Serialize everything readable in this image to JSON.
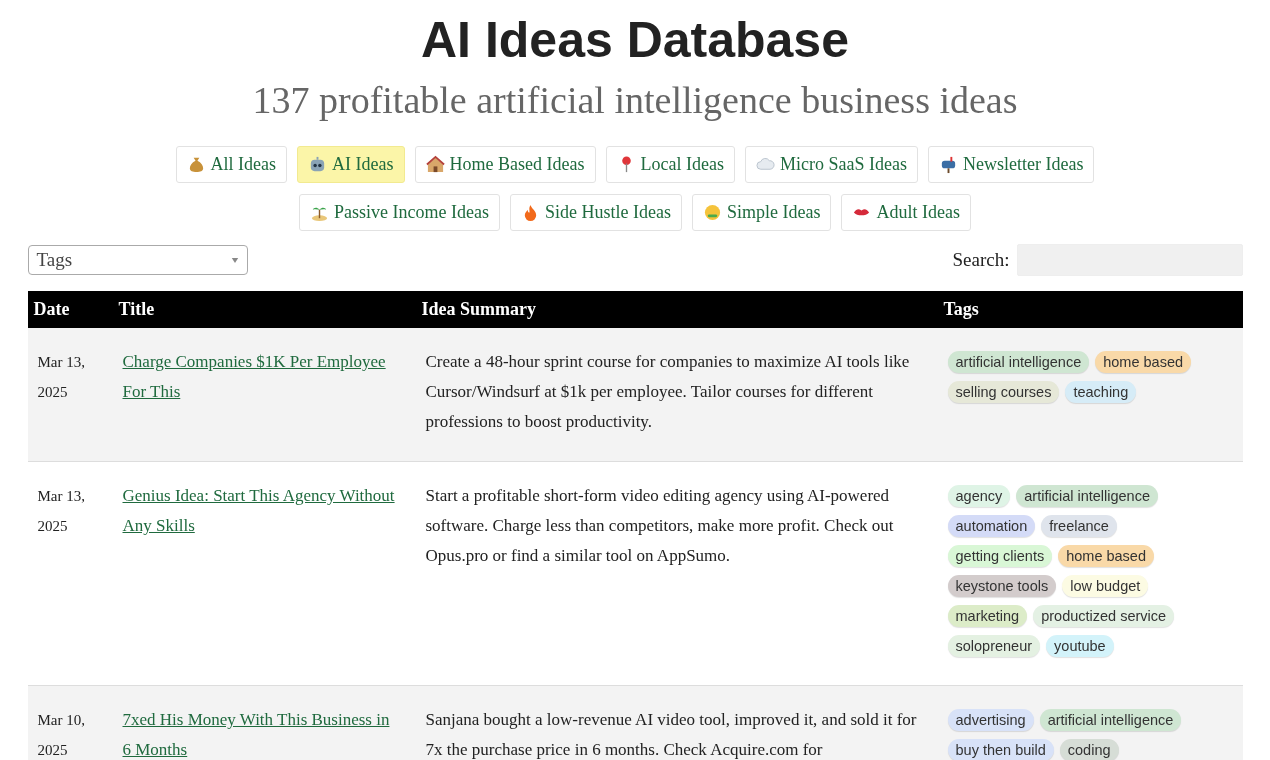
{
  "header": {
    "title": "AI Ideas Database",
    "subtitle": "137 profitable artificial intelligence business ideas"
  },
  "categories": [
    {
      "label": "All Ideas",
      "selected": false
    },
    {
      "label": "AI Ideas",
      "selected": true
    },
    {
      "label": "Home Based Ideas",
      "selected": false
    },
    {
      "label": "Local Ideas",
      "selected": false
    },
    {
      "label": "Micro SaaS Ideas",
      "selected": false
    },
    {
      "label": "Newsletter Ideas",
      "selected": false
    },
    {
      "label": "Passive Income Ideas",
      "selected": false
    },
    {
      "label": "Side Hustle Ideas",
      "selected": false
    },
    {
      "label": "Simple Ideas",
      "selected": false
    },
    {
      "label": "Adult Ideas",
      "selected": false
    }
  ],
  "filters": {
    "tags_placeholder": "Tags",
    "search_label": "Search:"
  },
  "table": {
    "columns": [
      "Date",
      "Title",
      "Idea Summary",
      "Tags"
    ],
    "rows": [
      {
        "date": "Mar 13, 2025",
        "title": "Charge Companies $1K Per Employee For This",
        "summary": "Create a 48-hour sprint course for companies to maximize AI tools like Cursor/Windsurf at $1k per employee. Tailor courses for different professions to boost productivity.",
        "tags": [
          {
            "label": "artificial intelligence",
            "color": "#cfe6d2"
          },
          {
            "label": "home based",
            "color": "#f9d9a8"
          },
          {
            "label": "selling courses",
            "color": "#e6e8d8"
          },
          {
            "label": "teaching",
            "color": "#d6ecf7"
          }
        ]
      },
      {
        "date": "Mar 13, 2025",
        "title": "Genius Idea: Start This Agency Without Any Skills",
        "summary": "Start a profitable short-form video editing agency using AI-powered software. Charge less than competitors, make more profit. Check out Opus.pro or find a similar tool on AppSumo.",
        "tags": [
          {
            "label": "agency",
            "color": "#dff4e6"
          },
          {
            "label": "artificial intelligence",
            "color": "#cfe6d2"
          },
          {
            "label": "automation",
            "color": "#d4dbf7"
          },
          {
            "label": "freelance",
            "color": "#dfe4ec"
          },
          {
            "label": "getting clients",
            "color": "#d9f7d6"
          },
          {
            "label": "home based",
            "color": "#f9d9a8"
          },
          {
            "label": "keystone tools",
            "color": "#d3cccc"
          },
          {
            "label": "low budget",
            "color": "#fcfbe3"
          },
          {
            "label": "marketing",
            "color": "#dcecc8"
          },
          {
            "label": "productized service",
            "color": "#e4f1e4"
          },
          {
            "label": "solopreneur",
            "color": "#e4f1e2"
          },
          {
            "label": "youtube",
            "color": "#d3f3fa"
          }
        ]
      },
      {
        "date": "Mar 10, 2025",
        "title": "7xed His Money With This Business in 6 Months",
        "summary": "Sanjana bought a low-revenue AI video tool, improved it, and sold it for 7x the purchase price in 6 months. Check Acquire.com for",
        "tags": [
          {
            "label": "advertising",
            "color": "#d8e2f8"
          },
          {
            "label": "artificial intelligence",
            "color": "#cfe6d2"
          },
          {
            "label": "buy then build",
            "color": "#d8e2f8"
          },
          {
            "label": "coding",
            "color": "#d6ddd6"
          }
        ]
      }
    ]
  }
}
